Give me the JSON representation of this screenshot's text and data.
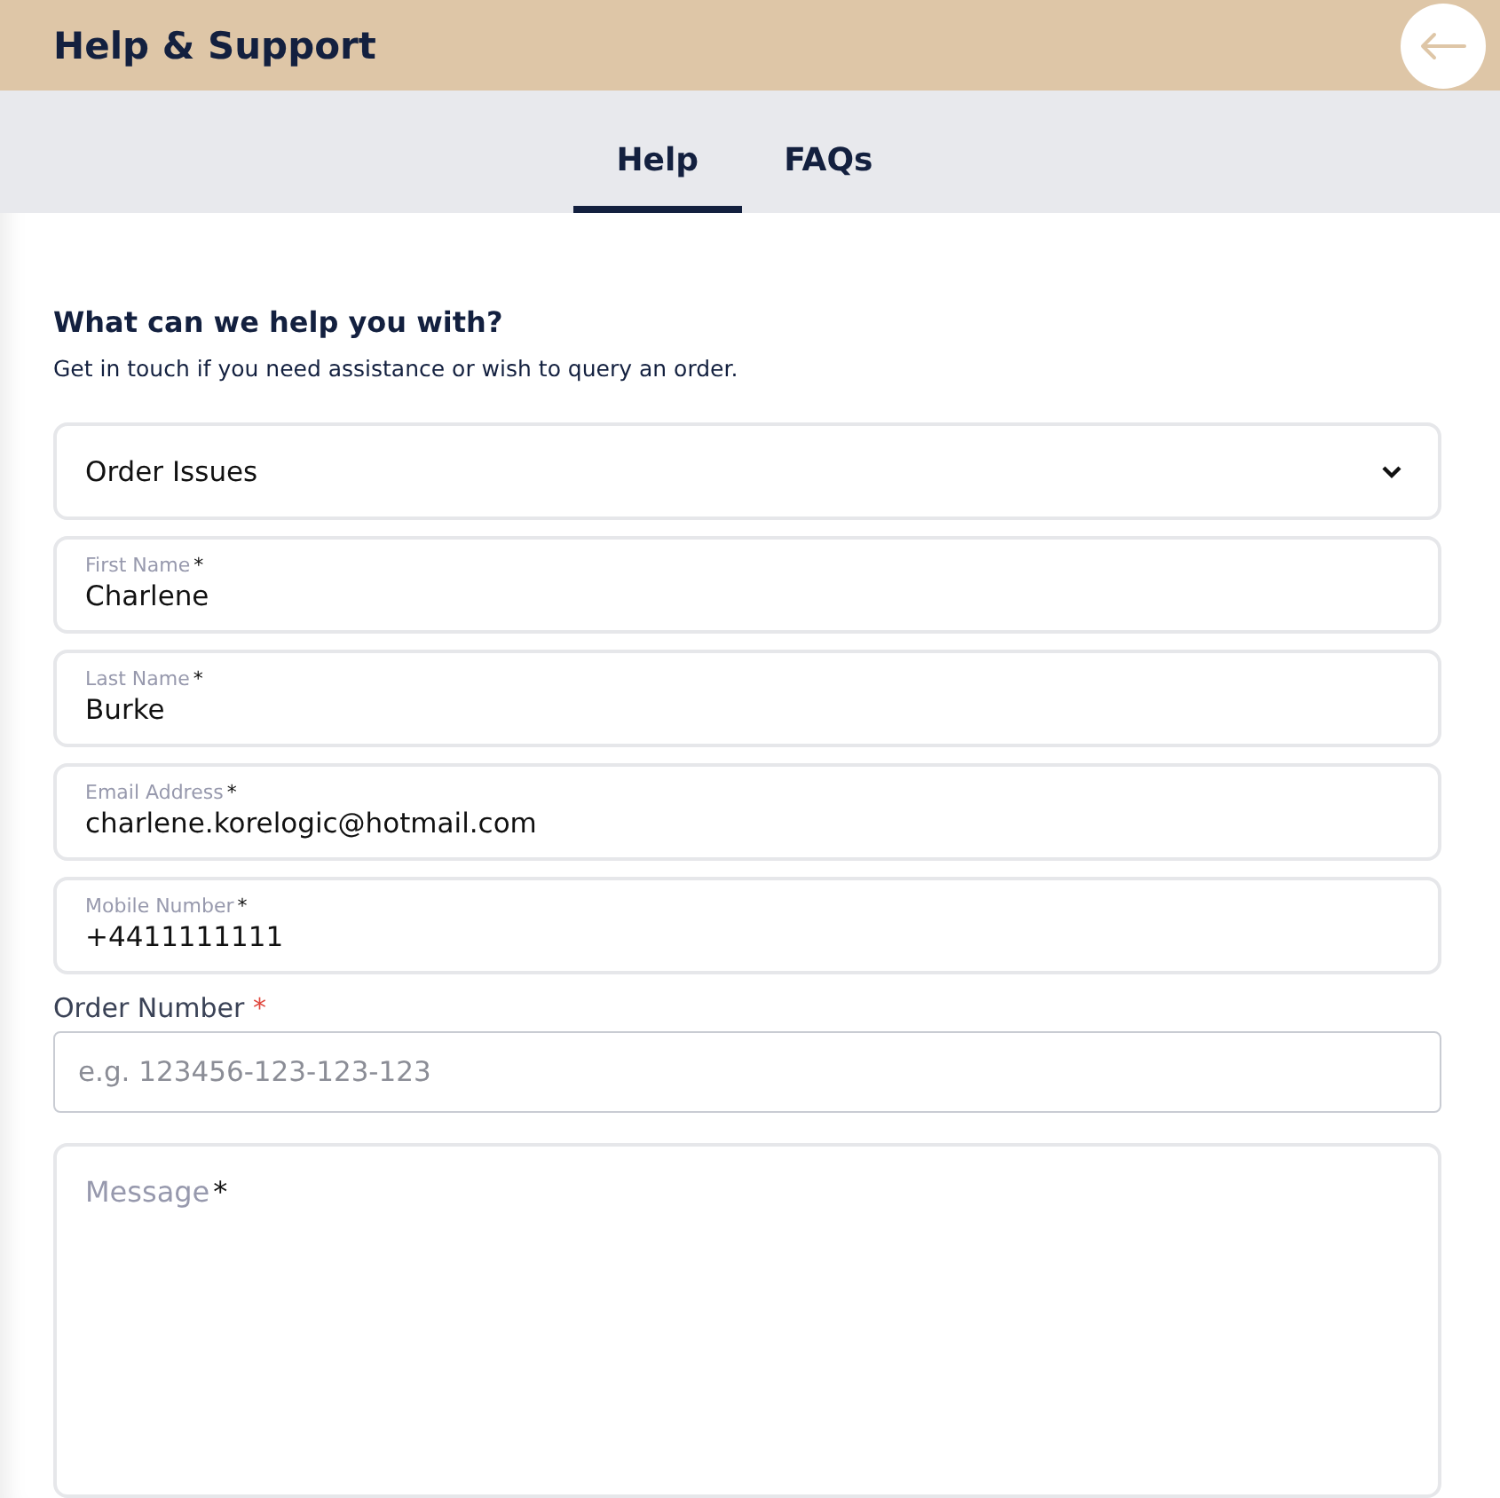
{
  "header": {
    "title": "Help & Support"
  },
  "tabs": [
    {
      "label": "Help",
      "selected": true
    },
    {
      "label": "FAQs",
      "selected": false
    }
  ],
  "intro": {
    "heading": "What can we help you with?",
    "text": "Get in touch if you need assistance or wish to query an order."
  },
  "topic_select": {
    "value": "Order Issues"
  },
  "fields": [
    {
      "label": "First Name",
      "required_mark": "*",
      "value": "Charlene"
    },
    {
      "label": "Last Name",
      "required_mark": "*",
      "value": "Burke"
    },
    {
      "label": "Email Address",
      "required_mark": "*",
      "value": "charlene.korelogic@hotmail.com"
    },
    {
      "label": "Mobile Number",
      "required_mark": "*",
      "value": "+4411111111"
    }
  ],
  "order_number": {
    "label": "Order Number",
    "required_mark": "*",
    "placeholder": "e.g. 123456-123-123-123"
  },
  "message": {
    "placeholder": "Message",
    "required_mark": "*"
  }
}
